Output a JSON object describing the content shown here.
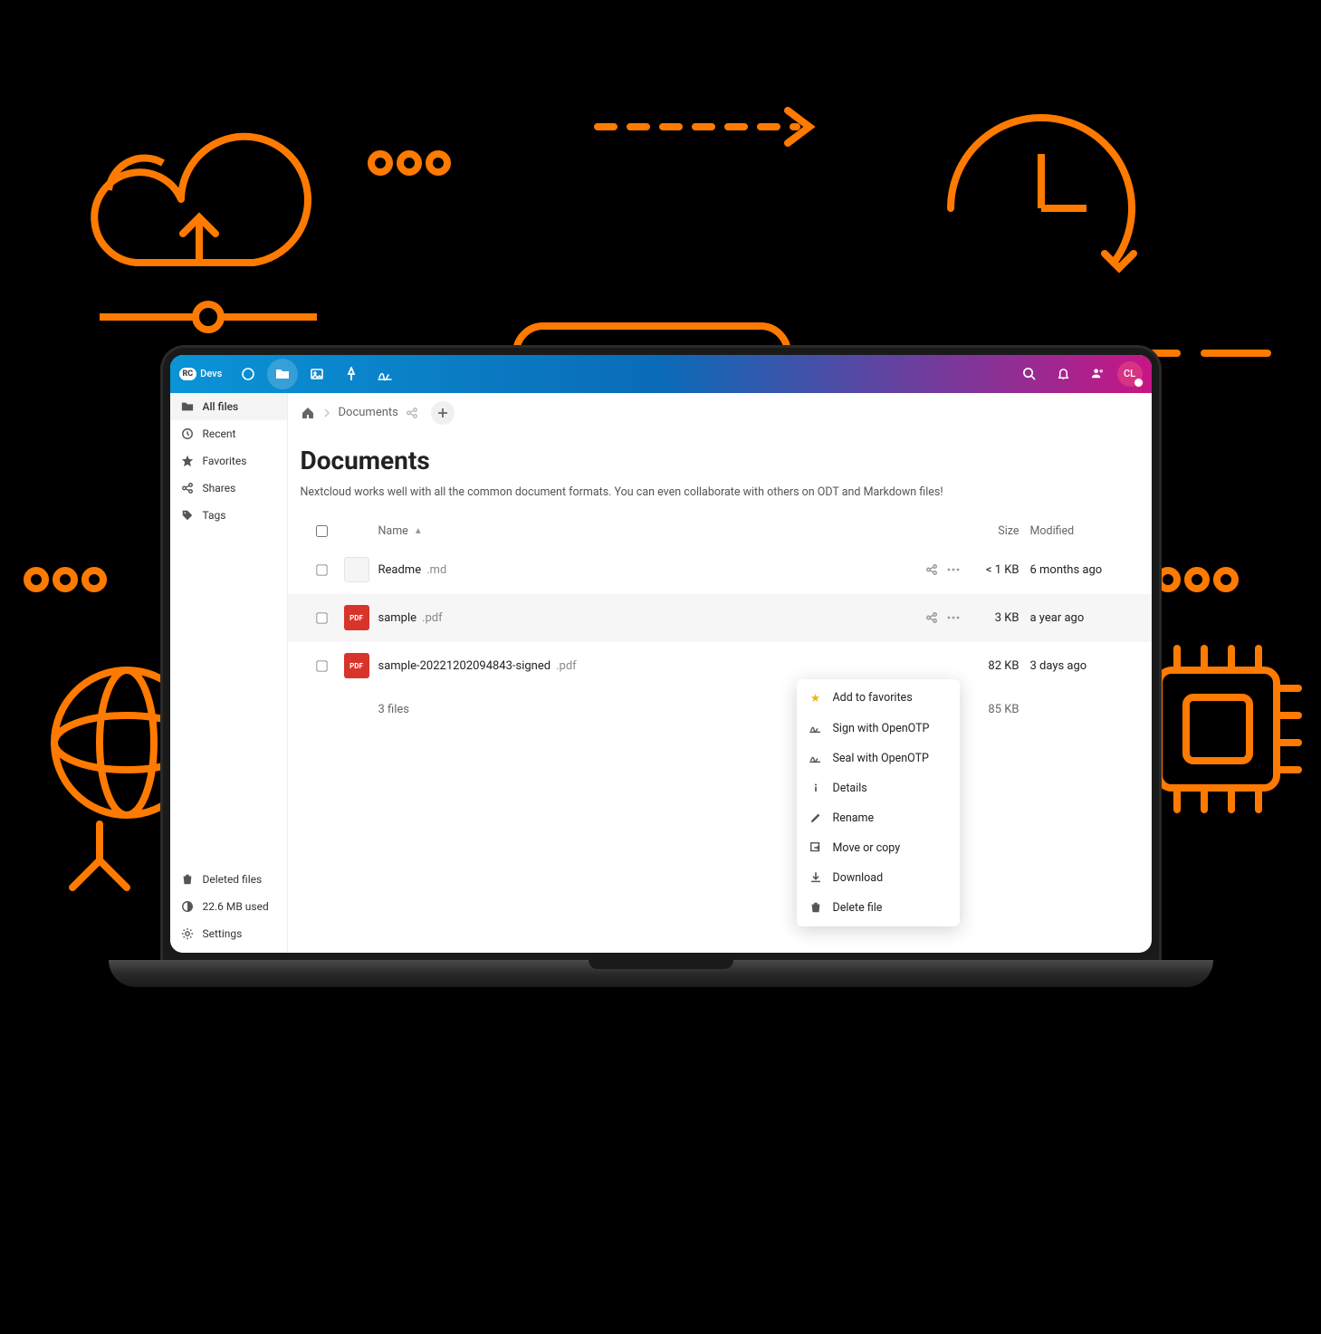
{
  "brand": {
    "badge": "RC",
    "suffix": "Devs"
  },
  "topbar": {
    "avatar_initials": "CL"
  },
  "sidebar": {
    "items": [
      {
        "label": "All files"
      },
      {
        "label": "Recent"
      },
      {
        "label": "Favorites"
      },
      {
        "label": "Shares"
      },
      {
        "label": "Tags"
      }
    ],
    "footer": {
      "deleted": "Deleted files",
      "storage": "22.6 MB used",
      "settings": "Settings"
    }
  },
  "breadcrumb": {
    "current": "Documents"
  },
  "folder": {
    "title": "Documents",
    "description": "Nextcloud works well with all the common document formats. You can even collaborate with others on ODT and Markdown files!"
  },
  "columns": {
    "name": "Name",
    "size": "Size",
    "modified": "Modified"
  },
  "files": [
    {
      "icon_type": "md",
      "icon_label": "",
      "base": "Readme",
      "ext": ".md",
      "size": "< 1 KB",
      "modified": "6 months ago",
      "hovered": false,
      "show_actions": true
    },
    {
      "icon_type": "pdf",
      "icon_label": "PDF",
      "base": "sample",
      "ext": ".pdf",
      "size": "3 KB",
      "modified": "a year ago",
      "hovered": true,
      "show_actions": true
    },
    {
      "icon_type": "pdf",
      "icon_label": "PDF",
      "base": "sample-20221202094843-signed",
      "ext": ".pdf",
      "size": "82 KB",
      "modified": "3 days ago",
      "hovered": false,
      "show_actions": false
    }
  ],
  "summary": {
    "count": "3 files",
    "size": "85 KB"
  },
  "context_menu": {
    "favorites": "Add to favorites",
    "sign": "Sign with OpenOTP",
    "seal": "Seal with OpenOTP",
    "details": "Details",
    "rename": "Rename",
    "move": "Move or copy",
    "download": "Download",
    "delete": "Delete file"
  },
  "deco": {
    "accent": "#ff7a00"
  }
}
